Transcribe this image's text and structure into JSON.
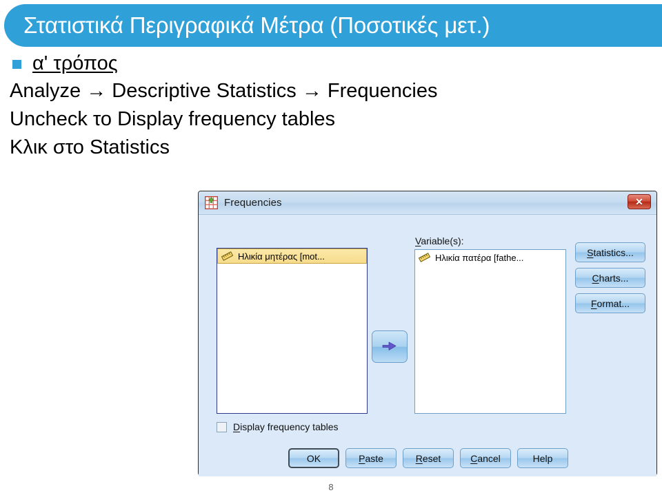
{
  "slide": {
    "title": "Στατιστικά Περιγραφικά Μέτρα (Ποσοτικές μετ.)",
    "banner_color": "#2fa0d8",
    "page_number": "8",
    "bullet": {
      "label": "α' τρόπος"
    },
    "lines": [
      "Analyze → Descriptive Statistics → Frequencies",
      "Uncheck το Display frequency tables",
      "Κλικ στο Statistics"
    ]
  },
  "dialog": {
    "title": "Frequencies",
    "icon": "spss-frequencies-icon",
    "close_label": "✕",
    "source_list": {
      "items": [
        {
          "label": "Ηλικία μητέρας [mot...",
          "icon": "ruler-icon",
          "selected": true
        }
      ]
    },
    "target_list": {
      "label_prefix": "V",
      "label_rest": "ariable(s):",
      "items": [
        {
          "label": "Ηλικία πατέρα [fathe...",
          "icon": "ruler-icon",
          "selected": false
        }
      ]
    },
    "move_button": {
      "icon": "arrow-right-icon"
    },
    "side_buttons": [
      {
        "accel": "S",
        "rest": "tatistics..."
      },
      {
        "accel": "C",
        "rest": "harts..."
      },
      {
        "accel": "F",
        "rest": "ormat..."
      }
    ],
    "checkbox": {
      "accel": "D",
      "rest": "isplay frequency tables",
      "checked": false
    },
    "bottom_buttons": [
      {
        "accel": "",
        "rest": "OK",
        "default": true
      },
      {
        "accel": "P",
        "rest": "aste",
        "default": false
      },
      {
        "accel": "R",
        "rest": "eset",
        "default": false
      },
      {
        "accel": "C",
        "rest": "ancel",
        "default": false
      },
      {
        "accel": "",
        "rest": "Help",
        "default": false
      }
    ]
  }
}
